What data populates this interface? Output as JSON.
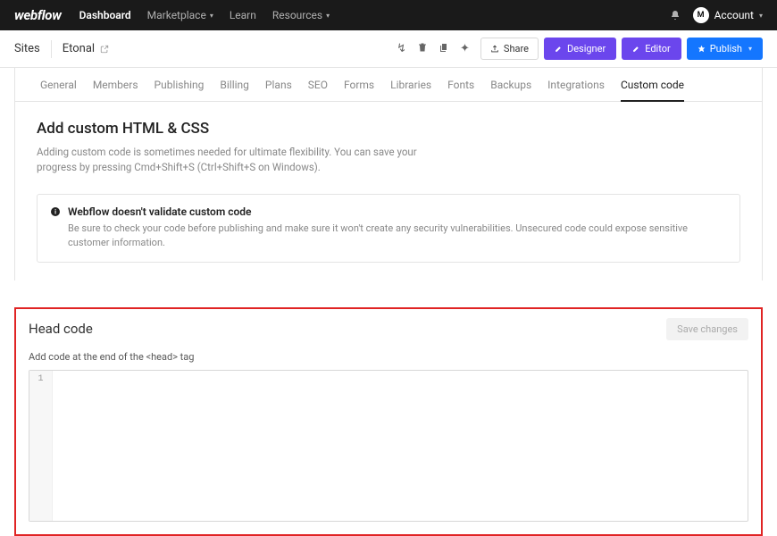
{
  "brand": "webflow",
  "topnav": {
    "dashboard": "Dashboard",
    "marketplace": "Marketplace",
    "learn": "Learn",
    "resources": "Resources"
  },
  "account": {
    "label": "Account",
    "initial": "M"
  },
  "sitebar": {
    "sites": "Sites",
    "site_name": "Etonal",
    "share": "Share",
    "designer": "Designer",
    "editor": "Editor",
    "publish": "Publish"
  },
  "tabs": [
    "General",
    "Members",
    "Publishing",
    "Billing",
    "Plans",
    "SEO",
    "Forms",
    "Libraries",
    "Fonts",
    "Backups",
    "Integrations",
    "Custom code"
  ],
  "active_tab": "Custom code",
  "section": {
    "title": "Add custom HTML & CSS",
    "desc": "Adding custom code is sometimes needed for ultimate flexibility. You can save your progress by pressing Cmd+Shift+S (Ctrl+Shift+S on Windows)."
  },
  "alert": {
    "title": "Webflow doesn't validate custom code",
    "body": "Be sure to check your code before publishing and make sure it won't create any security vulnerabilities. Unsecured code could expose sensitive customer information."
  },
  "head_code": {
    "title": "Head code",
    "save": "Save changes",
    "label": "Add code at the end of the <head> tag",
    "line_number": "1",
    "content": ""
  }
}
